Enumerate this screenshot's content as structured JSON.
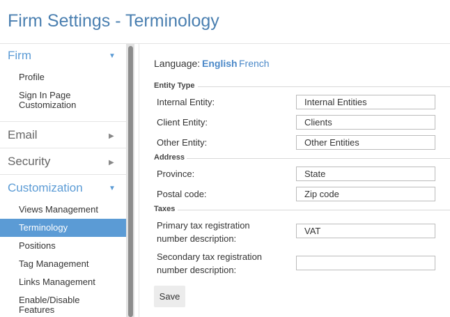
{
  "page_title": "Firm Settings - Terminology",
  "sidebar": {
    "firm": {
      "label": "Firm",
      "items": [
        "Profile",
        "Sign In Page Customization"
      ]
    },
    "email": {
      "label": "Email"
    },
    "security": {
      "label": "Security"
    },
    "customization": {
      "label": "Customization",
      "items": [
        "Views Management",
        "Terminology",
        "Positions",
        "Tag Management",
        "Links Management",
        "Enable/Disable Features"
      ],
      "active": "Terminology"
    }
  },
  "language": {
    "label": "Language:",
    "options": [
      "English",
      "French"
    ],
    "selected": "English"
  },
  "groups": {
    "entity_type": "Entity Type",
    "address": "Address",
    "taxes": "Taxes"
  },
  "fields": {
    "internal_entity": {
      "label": "Internal Entity:",
      "value": "Internal Entities"
    },
    "client_entity": {
      "label": "Client Entity:",
      "value": "Clients"
    },
    "other_entity": {
      "label": "Other Entity:",
      "value": "Other Entities"
    },
    "province": {
      "label": "Province:",
      "value": "State"
    },
    "postal_code": {
      "label": "Postal code:",
      "value": "Zip code"
    },
    "primary_tax": {
      "label_line1": "Primary tax registration",
      "label_line2": "number description:",
      "value": "VAT"
    },
    "secondary_tax": {
      "label_line1": "Secondary tax registration",
      "label_line2": "number description:",
      "value": ""
    }
  },
  "save_label": "Save",
  "colors": {
    "accent": "#5b9bd5",
    "title": "#4a7fb0",
    "link": "#4a88c8"
  }
}
